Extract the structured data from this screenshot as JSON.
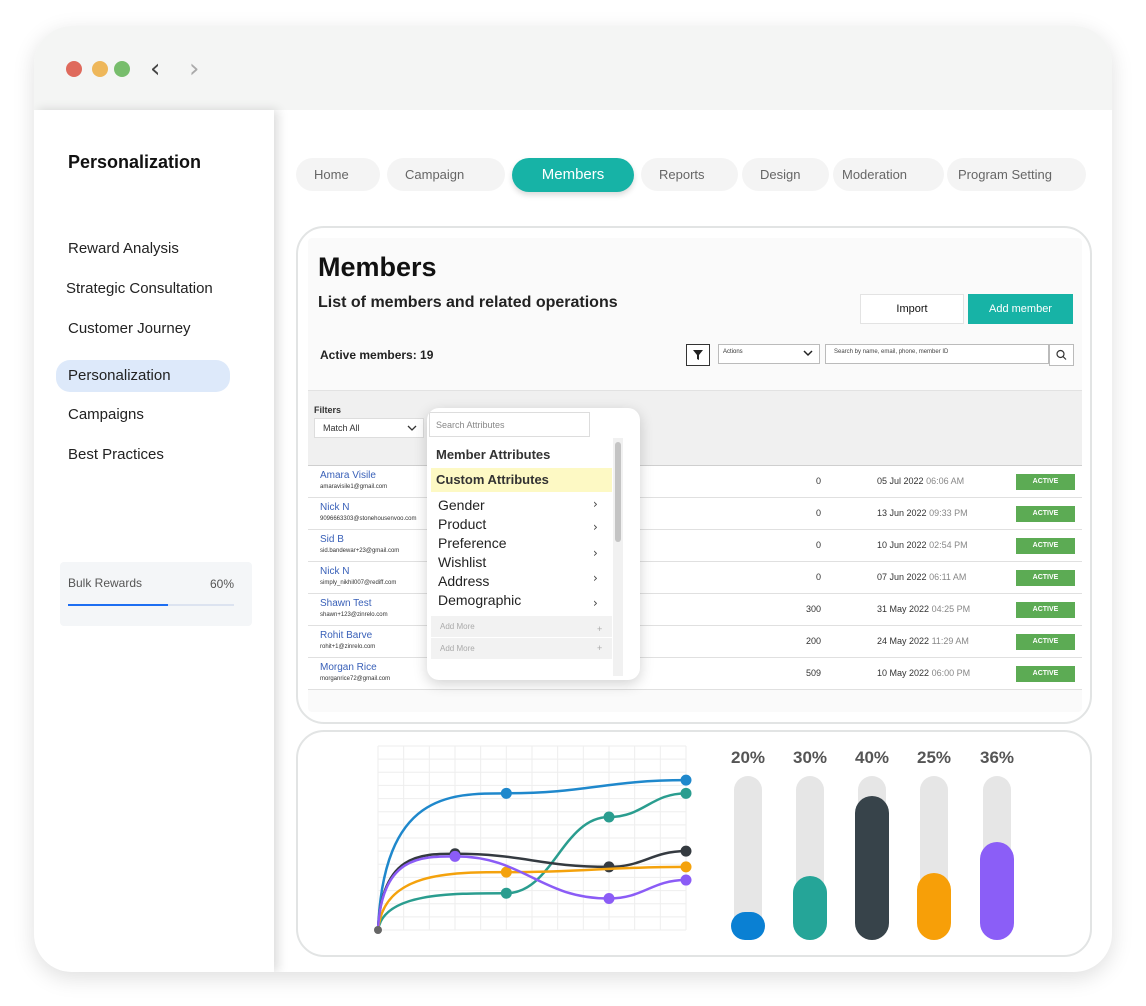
{
  "sidebar": {
    "title": "Personalization",
    "items": [
      {
        "label": "Reward Analysis"
      },
      {
        "label": "Strategic Consultation"
      },
      {
        "label": "Customer Journey"
      },
      {
        "label": "Personalization"
      },
      {
        "label": "Campaigns"
      },
      {
        "label": "Best Practices"
      }
    ],
    "active_item": "Personalization",
    "bulk": {
      "label": "Bulk Rewards",
      "percent": "60%",
      "progress": 0.6
    }
  },
  "tabs": [
    {
      "label": "Home"
    },
    {
      "label": "Campaign"
    },
    {
      "label": "Members"
    },
    {
      "label": "Reports"
    },
    {
      "label": "Design"
    },
    {
      "label": "Moderation"
    },
    {
      "label": "Program Setting"
    }
  ],
  "active_tab": "Members",
  "members": {
    "title": "Members",
    "subtitle": "List of members and related operations",
    "import_label": "Import",
    "add_label": "Add member",
    "active_count": "Active members: 19",
    "actions_label": "Actions",
    "search_placeholder": "Search by name, email, phone, member ID",
    "filters_label": "Filters",
    "match_label": "Match All",
    "rows": [
      {
        "name": "Amara Visile",
        "email": "amaravisile1@gmail.com",
        "points": "0",
        "date": "05 Jul 2022",
        "time": "06:06 AM",
        "status": "ACTIVE"
      },
      {
        "name": "Nick N",
        "email": "9096663303@stonehousenvoo.com",
        "points": "0",
        "date": "13 Jun 2022",
        "time": "09:33 PM",
        "status": "ACTIVE"
      },
      {
        "name": "Sid B",
        "email": "sid.bandewar+23@gmail.com",
        "points": "0",
        "date": "10 Jun 2022",
        "time": "02:54 PM",
        "status": "ACTIVE"
      },
      {
        "name": "Nick N",
        "email": "simply_nikhil007@rediff.com",
        "points": "0",
        "date": "07 Jun 2022",
        "time": "06:11 AM",
        "status": "ACTIVE"
      },
      {
        "name": "Shawn Test",
        "email": "shawn+123@zinrelo.com",
        "points": "300",
        "date": "31 May 2022",
        "time": "04:25 PM",
        "status": "ACTIVE"
      },
      {
        "name": "Rohit Barve",
        "email": "rohit+1@zinrelo.com",
        "points": "200",
        "date": "24 May 2022",
        "time": "11:29 AM",
        "status": "ACTIVE"
      },
      {
        "name": "Morgan Rice",
        "email": "morganrice72@gmail.com",
        "points": "509",
        "date": "10 May 2022",
        "time": "06:00 PM",
        "status": "ACTIVE"
      }
    ]
  },
  "dropdown": {
    "search_placeholder": "Search Attributes",
    "heading": "Member Attributes",
    "custom_heading": "Custom Attributes",
    "items": [
      {
        "label": "Gender"
      },
      {
        "label": "Product"
      },
      {
        "label": "Preference"
      },
      {
        "label": "Wishlist"
      },
      {
        "label": "Address"
      },
      {
        "label": "Demographic"
      }
    ],
    "add_more": [
      "Add More",
      "Add More"
    ]
  },
  "chart_data": [
    {
      "type": "line",
      "x": [
        0,
        1,
        2,
        3,
        4,
        5,
        6,
        7,
        8,
        9,
        10,
        11,
        12
      ],
      "ylim": [
        0,
        7
      ],
      "grid": true,
      "series": [
        {
          "color": "#1f88cc",
          "points": [
            [
              0,
              0
            ],
            [
              5,
              5.2
            ],
            [
              12,
              5.7
            ]
          ]
        },
        {
          "color": "#2a9d8f",
          "points": [
            [
              0,
              0
            ],
            [
              5,
              1.4
            ],
            [
              9,
              4.3
            ],
            [
              12,
              5.2
            ]
          ]
        },
        {
          "color": "#343a40",
          "points": [
            [
              0,
              0
            ],
            [
              3,
              2.9
            ],
            [
              9,
              2.4
            ],
            [
              12,
              3.0
            ]
          ]
        },
        {
          "color": "#f4a20c",
          "points": [
            [
              0,
              0
            ],
            [
              5,
              2.2
            ],
            [
              12,
              2.4
            ]
          ]
        },
        {
          "color": "#8b5cf6",
          "points": [
            [
              0,
              0
            ],
            [
              3,
              2.8
            ],
            [
              9,
              1.2
            ],
            [
              12,
              1.9
            ]
          ]
        }
      ]
    },
    {
      "type": "bar",
      "orientation": "vertical",
      "values": [
        20,
        30,
        40,
        25,
        36
      ],
      "labels": [
        "20%",
        "30%",
        "40%",
        "25%",
        "36%"
      ],
      "colors": [
        "#0a80d3",
        "#25a598",
        "#37434a",
        "#f79f08",
        "#8b5ef7"
      ],
      "fill_fractions": [
        0.17,
        0.39,
        0.88,
        0.41,
        0.6
      ]
    }
  ],
  "colors": {
    "accent": "#17b3a6",
    "status": "#5cab54",
    "link": "#3960b8"
  }
}
